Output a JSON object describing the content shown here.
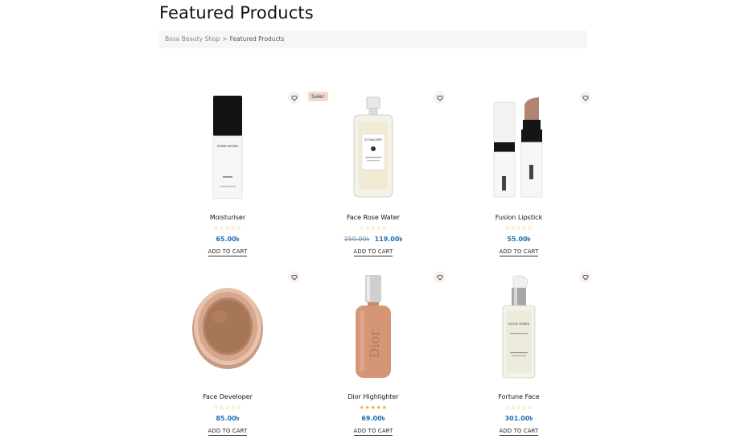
{
  "page": {
    "title": "Featured Products"
  },
  "breadcrumb": {
    "home": "Bosa Beauty Shop",
    "separator": ">",
    "current": "Featured Products"
  },
  "products": [
    {
      "name": "Moisturiser",
      "price": "65.00৳",
      "old_price": "",
      "rating": 0,
      "sale": "",
      "cart": "ADD TO CART"
    },
    {
      "name": "Face Rose Water",
      "price": "119.00৳",
      "old_price": "150.00৳",
      "rating": 0,
      "sale": "Sale!",
      "cart": "ADD TO CART"
    },
    {
      "name": "Fusion Lipstick",
      "price": "55.00৳",
      "old_price": "",
      "rating": 0,
      "sale": "",
      "cart": "ADD TO CART"
    },
    {
      "name": "Face Developer",
      "price": "85.00৳",
      "old_price": "",
      "rating": 0,
      "sale": "",
      "cart": "ADD TO CART"
    },
    {
      "name": "Dior Highlighter",
      "price": "69.00৳",
      "old_price": "",
      "rating": 5,
      "sale": "",
      "cart": "ADD TO CART"
    },
    {
      "name": "Fortune Face",
      "price": "301.00৳",
      "old_price": "",
      "rating": 0,
      "sale": "",
      "cart": "ADD TO CART"
    }
  ],
  "images": {
    "moisturiser_brand": "BOBBI BROWN",
    "perfume_brand": "JO MALONE",
    "highlighter_brand": "Dior",
    "serum_brand": "GOOD GENES"
  },
  "colors": {
    "price": "#1f6fb2",
    "star": "#e6b422",
    "sale_bg": "#f3d8cf"
  }
}
